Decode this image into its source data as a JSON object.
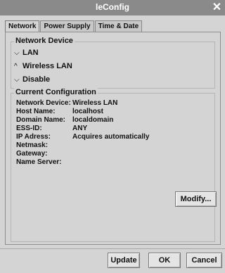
{
  "window": {
    "title": "leConfig",
    "close_glyph": "✕"
  },
  "tabs": [
    {
      "label": "Network",
      "active": true
    },
    {
      "label": "Power Supply",
      "active": false
    },
    {
      "label": "Time & Date",
      "active": false
    }
  ],
  "network_device": {
    "title": "Network Device",
    "options": [
      {
        "label": "LAN",
        "marker": "⌵",
        "icon": "radio-unselected-icon"
      },
      {
        "label": "Wireless LAN",
        "marker": "^",
        "icon": "radio-selected-icon"
      },
      {
        "label": "Disable",
        "marker": "⌵",
        "icon": "radio-unselected-icon"
      }
    ]
  },
  "current_configuration": {
    "title": "Current Configuration",
    "rows": [
      {
        "label": "Network Device:",
        "value": "Wireless LAN"
      },
      {
        "label": "Host Name:",
        "value": "localhost"
      },
      {
        "label": "Domain Name:",
        "value": "localdomain"
      },
      {
        "label": "ESS-ID:",
        "value": "ANY"
      },
      {
        "label": "IP Adress:",
        "value": "Acquires automatically"
      },
      {
        "label": "Netmask:",
        "value": ""
      },
      {
        "label": "Gateway:",
        "value": ""
      },
      {
        "label": "Name Server:",
        "value": ""
      }
    ],
    "modify_label": "Modify..."
  },
  "footer": {
    "update_label": "Update",
    "ok_label": "OK",
    "cancel_label": "Cancel"
  }
}
